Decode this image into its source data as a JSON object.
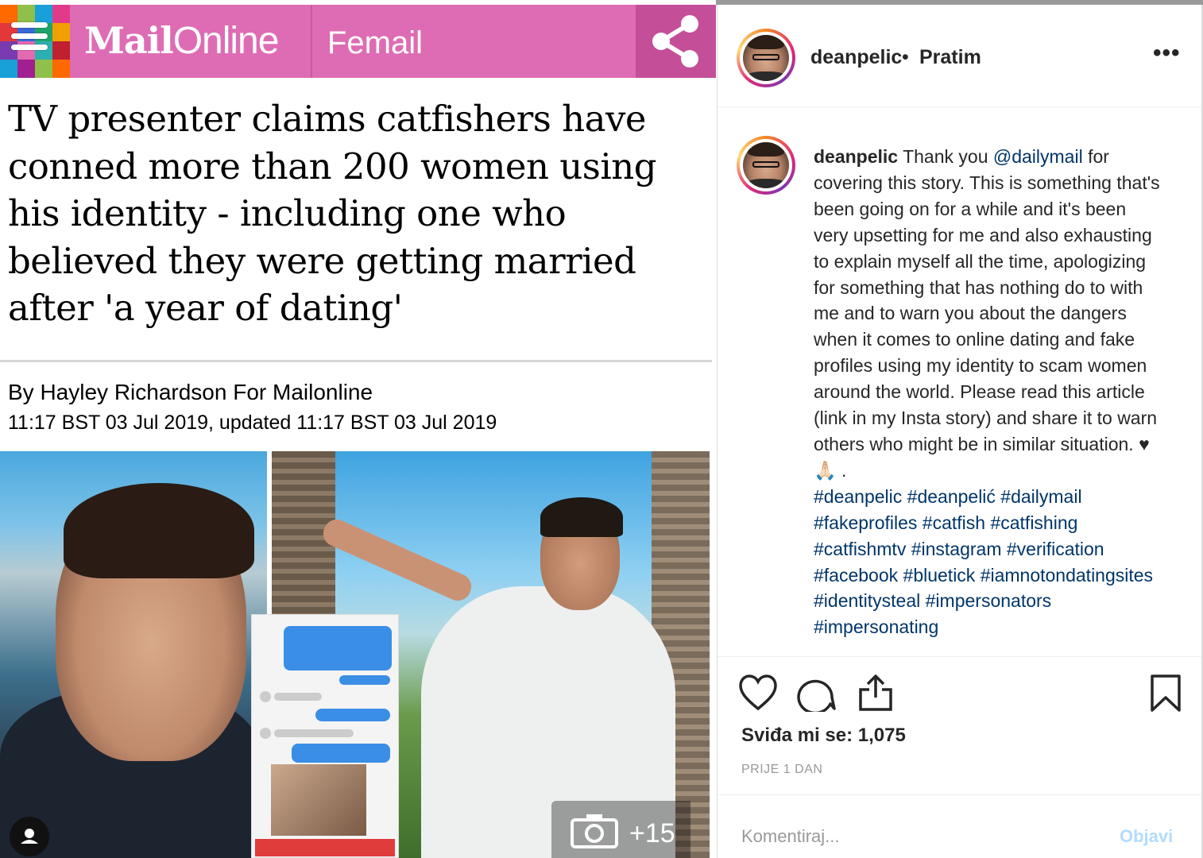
{
  "article": {
    "logo_mail": "Mail",
    "logo_online": "Online",
    "section": "Femail",
    "headline": "TV presenter claims catfishers have conned more than 200 women using his identity - including one who believed they were getting married after 'a year of dating'",
    "byline": "By Hayley Richardson For Mailonline",
    "dateline": "11:17 BST 03 Jul 2019, updated 11:17 BST 03 Jul 2019",
    "photo_count": "+15",
    "header_color": "#de6cb4"
  },
  "instagram": {
    "header": {
      "username": "deanpelic",
      "dot": "•",
      "follow_status": "Pratim",
      "more": "•••"
    },
    "caption": {
      "username": "deanpelic",
      "text_1": " Thank you ",
      "mention": "@dailymail",
      "text_2": " for covering this story. This is something that's been going on for a while and it's been very upsetting for me and also exhausting to explain myself all the time, apologizing for something that has nothing do to with me and to warn you about the dangers when it comes to online dating and fake profiles using my identity to scam women around the world. Please read this article (link in my Insta story) and share it to warn others who might be in similar situation. ♥🙏🏻 .",
      "hashtags": "#deanpelic #deanpelić #dailymail #fakeprofiles #catfish #catfishing #catfishmtv #instagram #verification #facebook #bluetick #iamnotondatingsites #identitysteal #impersonators #impersonating"
    },
    "likes": "Sviđa mi se: 1,075",
    "time_ago": "PRIJE 1 DAN",
    "comment_placeholder": "Komentiraj...",
    "post_label": "Objavi",
    "link_color": "#003569"
  }
}
